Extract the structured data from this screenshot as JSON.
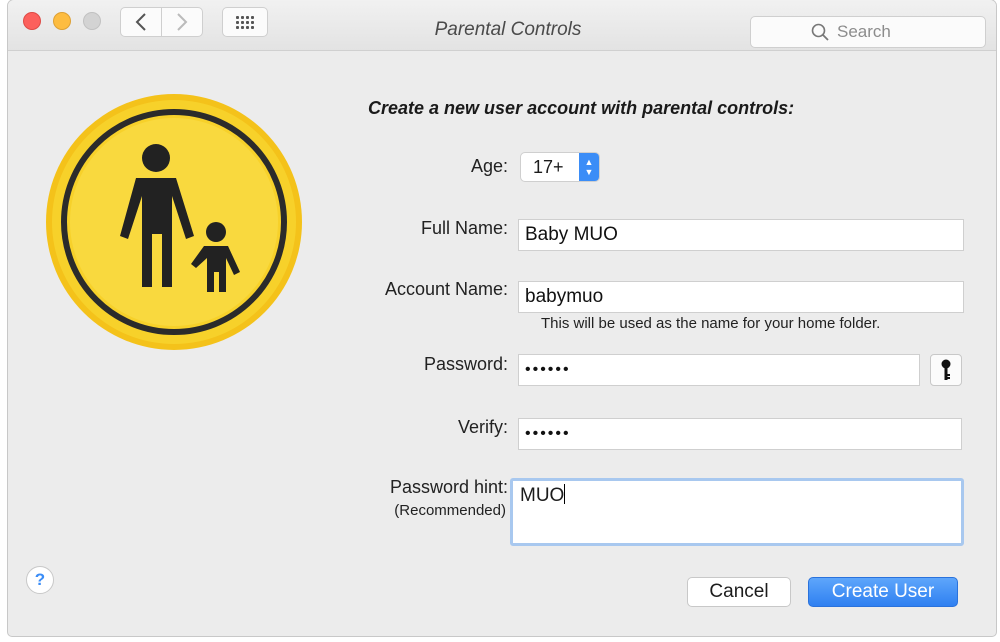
{
  "window": {
    "title": "Parental Controls"
  },
  "toolbar": {
    "search_placeholder": "Search"
  },
  "form": {
    "heading": "Create a new user account with parental controls:",
    "age": {
      "label": "Age:",
      "value": "17+"
    },
    "full_name": {
      "label": "Full Name:",
      "value": "Baby MUO"
    },
    "account_name": {
      "label": "Account Name:",
      "value": "babymuo",
      "note": "This will be used as the name for your home folder."
    },
    "password": {
      "label": "Password:",
      "value": "••••••"
    },
    "verify": {
      "label": "Verify:",
      "value": "••••••"
    },
    "hint": {
      "label": "Password hint:",
      "sublabel": "(Recommended)",
      "value": "MUO"
    }
  },
  "help": {
    "label": "?"
  },
  "buttons": {
    "cancel": "Cancel",
    "create": "Create User"
  },
  "colors": {
    "accent": "#3b8df7",
    "badge_yellow": "#f7d12a",
    "badge_ring": "#2b2b2b"
  }
}
